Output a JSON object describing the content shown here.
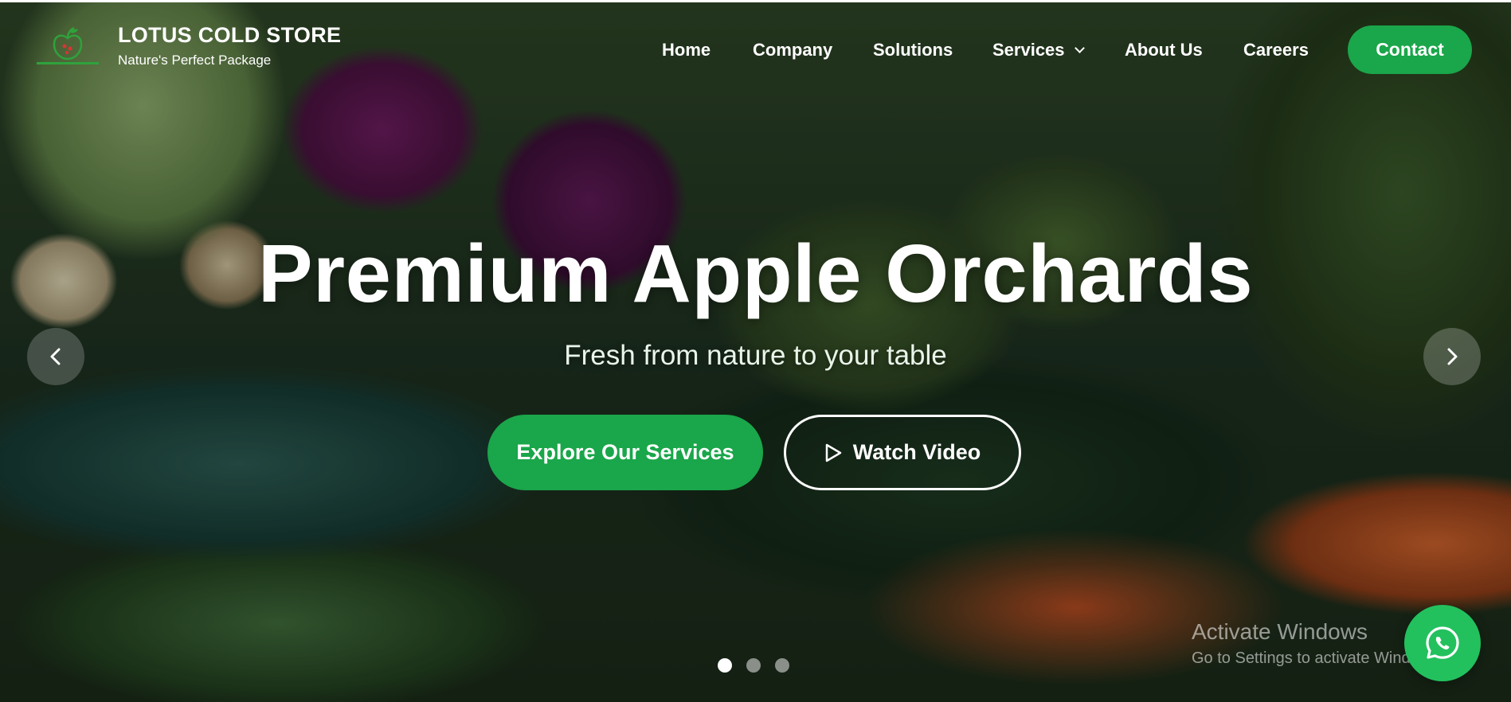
{
  "brand": {
    "title": "LOTUS COLD STORE",
    "tagline": "Nature's Perfect Package",
    "logo_icon": "apple-logo-icon",
    "accent_color": "#1aa64a"
  },
  "nav": {
    "items": [
      {
        "label": "Home"
      },
      {
        "label": "Company"
      },
      {
        "label": "Solutions"
      },
      {
        "label": "Services"
      },
      {
        "label": "About Us"
      },
      {
        "label": "Careers"
      }
    ],
    "contact_label": "Contact"
  },
  "hero": {
    "title": "Premium Apple Orchards",
    "subtitle": "Fresh from nature to your table",
    "primary_button": "Explore Our Services",
    "secondary_button": "Watch Video",
    "slides_count": 3,
    "active_slide": 1
  },
  "watermark": {
    "title": "Activate Windows",
    "subtitle": "Go to Settings to activate Windows."
  },
  "icons": {
    "prev": "chevron-left-icon",
    "next": "chevron-right-icon",
    "play": "play-icon",
    "whatsapp": "whatsapp-icon",
    "services_dropdown": "chevron-down-icon"
  }
}
